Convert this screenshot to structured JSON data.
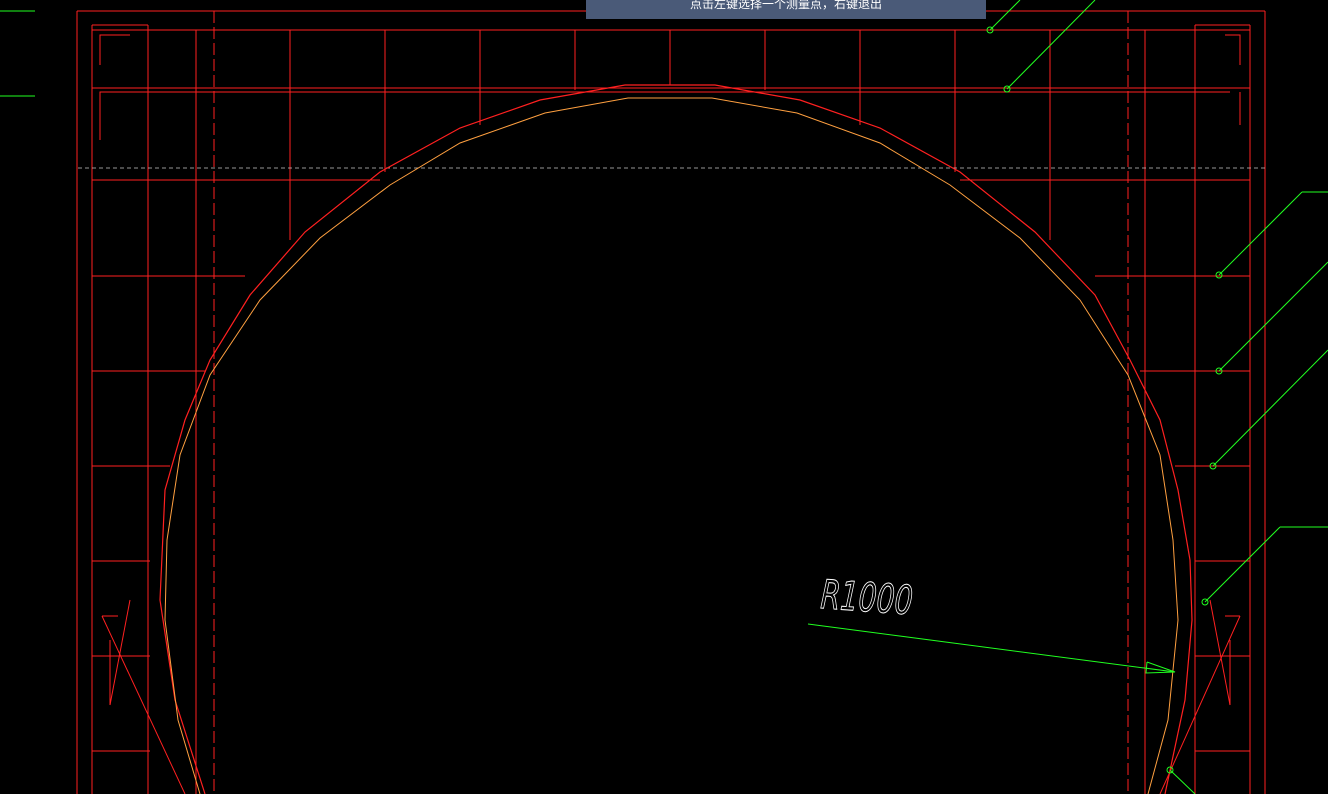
{
  "status_prompt": {
    "text": "点击左键选择一个测量点，右键退出"
  },
  "drawing": {
    "dimension_label": "R1000",
    "colors": {
      "background": "#000000",
      "frame": "#ff2020",
      "inner_arc": "#ffa040",
      "leader": "#20ff20",
      "dashed_line": "#c8c8c8",
      "text": "#ffffff",
      "prompt_bg": "#4a5a78"
    }
  }
}
